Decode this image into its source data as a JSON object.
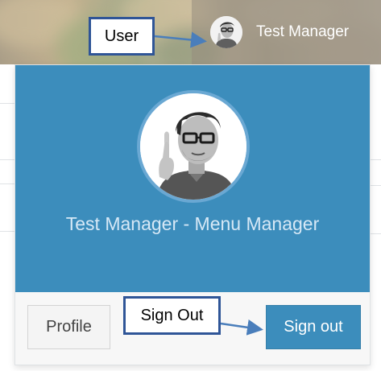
{
  "header": {
    "user_name": "Test Manager"
  },
  "dropdown": {
    "title": "Test Manager - Menu Manager",
    "profile_label": "Profile",
    "signout_label": "Sign out"
  },
  "annotations": {
    "user_label": "User",
    "signout_label": "Sign Out"
  },
  "colors": {
    "accent": "#3c8dbc",
    "callout_border": "#2f5597"
  }
}
